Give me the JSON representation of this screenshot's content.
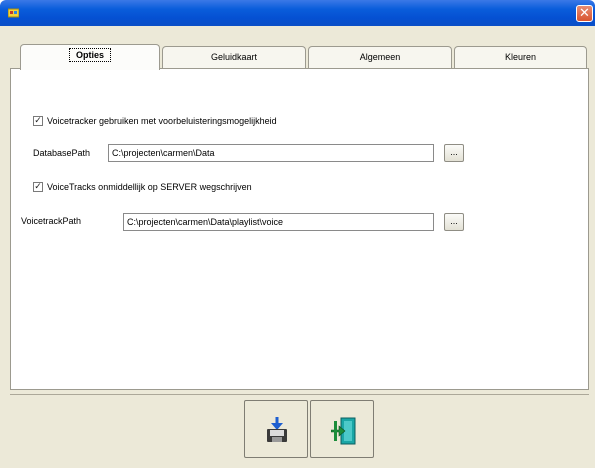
{
  "window": {
    "close_glyph": "✕"
  },
  "tabs": [
    {
      "label": "Opties",
      "active": true
    },
    {
      "label": "Geluidkaart",
      "active": false
    },
    {
      "label": "Algemeen",
      "active": false
    },
    {
      "label": "Kleuren",
      "active": false
    }
  ],
  "options": {
    "voicetracker_checkbox": {
      "label": "Voicetracker gebruiken met voorbeluisteringsmogelijkheid",
      "checked": true,
      "mark": "✓"
    },
    "database_path": {
      "label": "DatabasePath",
      "value": "C:\\projecten\\carmen\\Data",
      "browse_label": "..."
    },
    "write_server_checkbox": {
      "label": "VoiceTracks onmiddellijk op SERVER wegschrijven",
      "checked": true,
      "mark": "✓"
    },
    "voicetrack_path": {
      "label": "VoicetrackPath",
      "value": "C:\\projecten\\carmen\\Data\\playlist\\voice",
      "browse_label": "..."
    }
  },
  "toolbar": {
    "save_icon": "save-to-disk-icon",
    "exit_icon": "exit-door-icon"
  },
  "colors": {
    "titlebar": "#0a5ddb",
    "face": "#ece9d8",
    "exit_icon": "#1aa6a6",
    "save_arrow": "#1e5fd0"
  }
}
